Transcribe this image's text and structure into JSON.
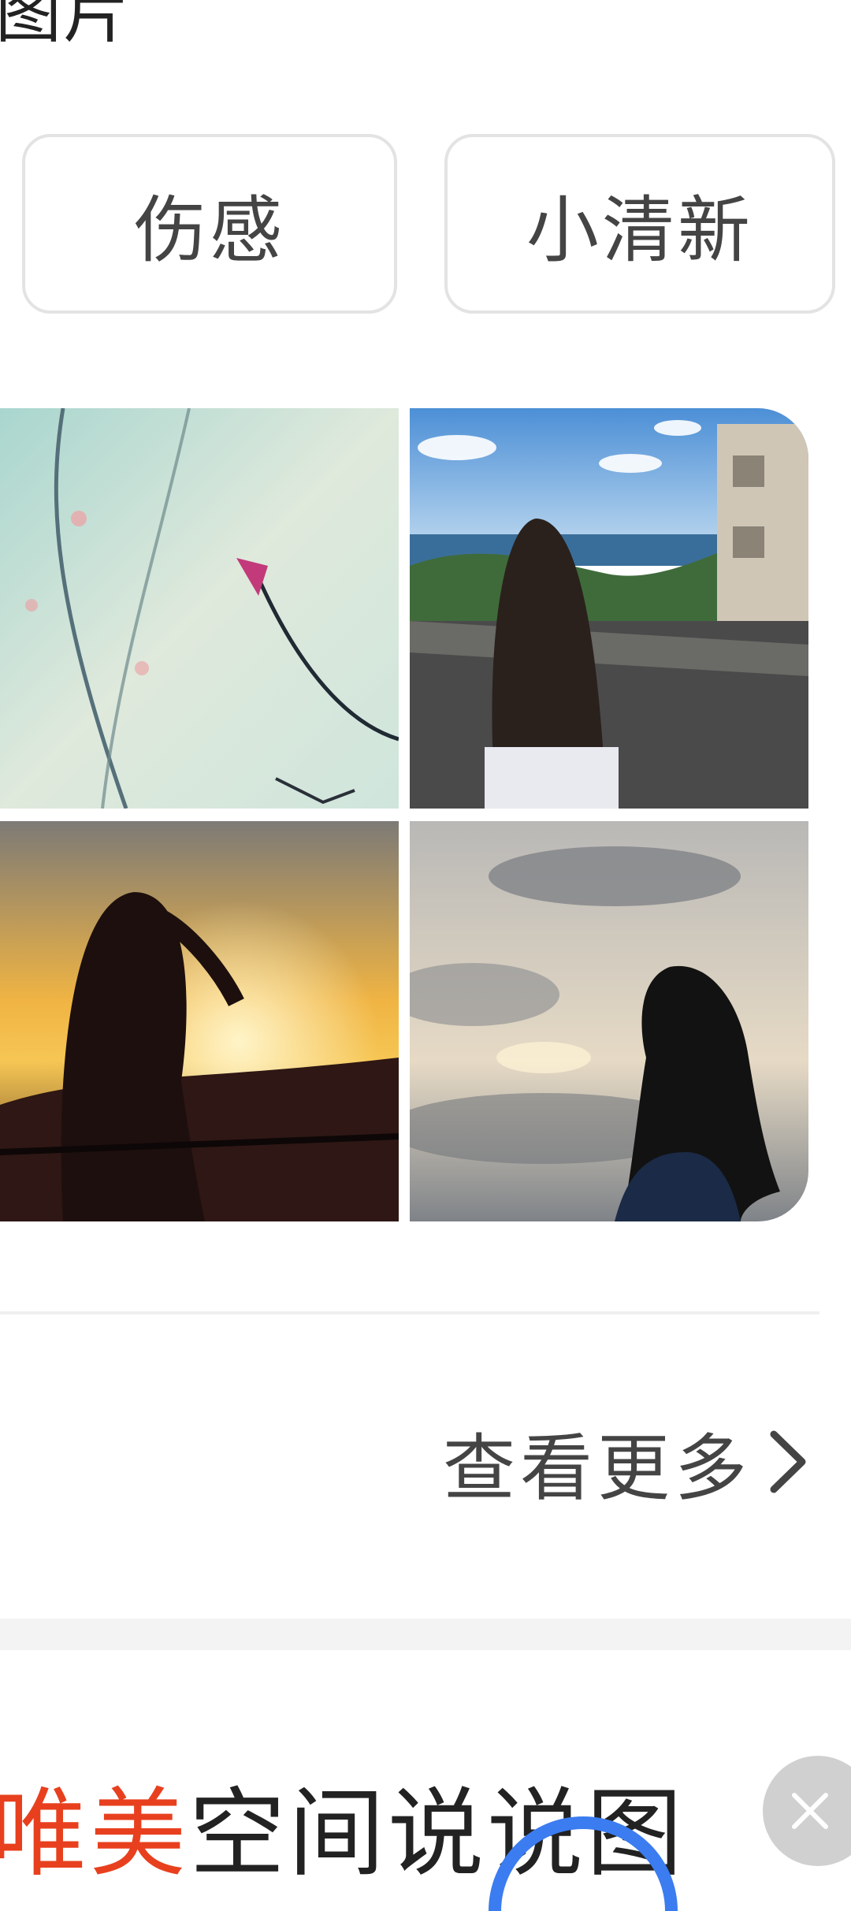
{
  "section": {
    "title_partial": "图片"
  },
  "tags": [
    {
      "label": "伤感"
    },
    {
      "label": "小清新"
    }
  ],
  "gallery": {
    "items": [
      {
        "name": "flower-branch-image"
      },
      {
        "name": "girl-sea-view-image"
      },
      {
        "name": "sunset-silhouette-image"
      },
      {
        "name": "cloudy-sky-girl-image"
      }
    ]
  },
  "more": {
    "label": "查看更多",
    "icon": "chevron-right-icon"
  },
  "next_section": {
    "title_accent": "唯美",
    "title_rest": "空间说说图"
  },
  "float_close": {
    "icon": "close-icon"
  },
  "colors": {
    "accent": "#e8401e",
    "text": "#444444",
    "border": "#e3e3e3"
  }
}
